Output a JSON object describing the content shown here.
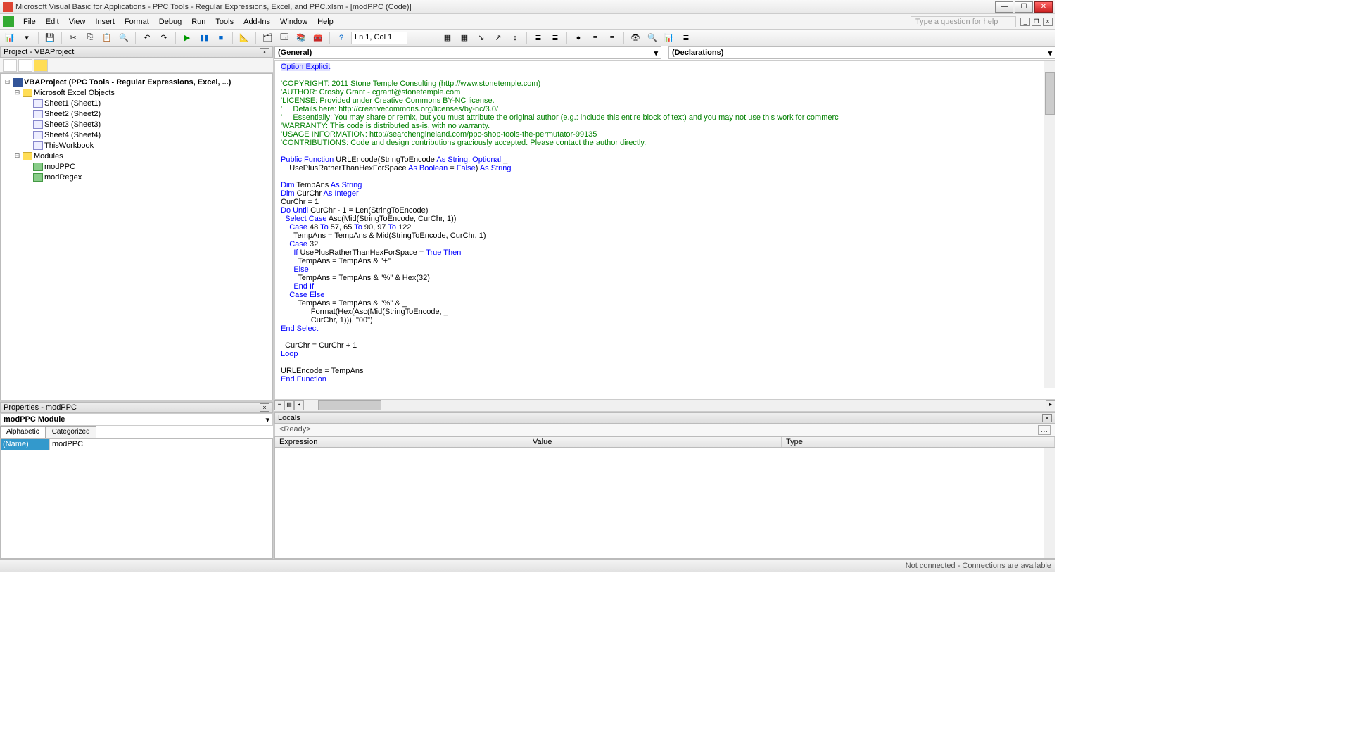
{
  "title": "Microsoft Visual Basic for Applications - PPC Tools - Regular Expressions, Excel, and PPC.xlsm - [modPPC (Code)]",
  "menus": [
    "File",
    "Edit",
    "View",
    "Insert",
    "Format",
    "Debug",
    "Run",
    "Tools",
    "Add-Ins",
    "Window",
    "Help"
  ],
  "question_placeholder": "Type a question for help",
  "position": "Ln 1, Col 1",
  "project": {
    "header": "Project - VBAProject",
    "root": "VBAProject (PPC Tools - Regular Expressions, Excel, ...)",
    "excel_folder": "Microsoft Excel Objects",
    "sheets": [
      "Sheet1 (Sheet1)",
      "Sheet2 (Sheet2)",
      "Sheet3 (Sheet3)",
      "Sheet4 (Sheet4)",
      "ThisWorkbook"
    ],
    "modules_folder": "Modules",
    "modules": [
      "modPPC",
      "modRegex"
    ]
  },
  "properties": {
    "header": "Properties - modPPC",
    "object": "modPPC Module",
    "tabs": [
      "Alphabetic",
      "Categorized"
    ],
    "name_key": "(Name)",
    "name_val": "modPPC"
  },
  "codecombo": {
    "left": "(General)",
    "right": "(Declarations)"
  },
  "locals": {
    "header": "Locals",
    "ready": "<Ready>",
    "cols": [
      "Expression",
      "Value",
      "Type"
    ]
  },
  "status": "Not connected - Connections are available",
  "code_lines": [
    {
      "t": "Option Explicit",
      "c": "kw",
      "hl": 1
    },
    {
      "t": ""
    },
    {
      "t": "'COPYRIGHT: 2011 Stone Temple Consulting (http://www.stonetemple.com)",
      "c": "cm"
    },
    {
      "t": "'AUTHOR: Crosby Grant - cgrant@stonetemple.com",
      "c": "cm"
    },
    {
      "t": "'LICENSE: Provided under Creative Commons BY-NC license.",
      "c": "cm"
    },
    {
      "t": "'     Details here: http://creativecommons.org/licenses/by-nc/3.0/",
      "c": "cm"
    },
    {
      "t": "'     Essentially: You may share or remix, but you must attribute the original author (e.g.: include this entire block of text) and you may not use this work for commerc",
      "c": "cm"
    },
    {
      "t": "'WARRANTY: This code is distributed as-is, with no warranty.",
      "c": "cm"
    },
    {
      "t": "'USAGE INFORMATION: http://searchengineland.com/ppc-shop-tools-the-permutator-99135",
      "c": "cm"
    },
    {
      "t": "'CONTRIBUTIONS: Code and design contributions graciously accepted. Please contact the author directly.",
      "c": "cm"
    },
    {
      "t": ""
    },
    {
      "t": "<kw>Public Function</kw> URLEncode(StringToEncode <kw>As String</kw>, <kw>Optional</kw> _"
    },
    {
      "t": "    UsePlusRatherThanHexForSpace <kw>As Boolean</kw> = <kw>False</kw>) <kw>As String</kw>"
    },
    {
      "t": ""
    },
    {
      "t": "<kw>Dim</kw> TempAns <kw>As String</kw>"
    },
    {
      "t": "<kw>Dim</kw> CurChr <kw>As Integer</kw>"
    },
    {
      "t": "CurChr = 1"
    },
    {
      "t": "<kw>Do Until</kw> CurChr - 1 = Len(StringToEncode)"
    },
    {
      "t": "  <kw>Select Case</kw> Asc(Mid(StringToEncode, CurChr, 1))"
    },
    {
      "t": "    <kw>Case</kw> 48 <kw>To</kw> 57, 65 <kw>To</kw> 90, 97 <kw>To</kw> 122"
    },
    {
      "t": "      TempAns = TempAns &amp; Mid(StringToEncode, CurChr, 1)"
    },
    {
      "t": "    <kw>Case</kw> 32"
    },
    {
      "t": "      <kw>If</kw> UsePlusRatherThanHexForSpace = <kw>True Then</kw>"
    },
    {
      "t": "        TempAns = TempAns &amp; \"+\""
    },
    {
      "t": "      <kw>Else</kw>"
    },
    {
      "t": "        TempAns = TempAns &amp; \"%\" &amp; Hex(32)"
    },
    {
      "t": "      <kw>End If</kw>"
    },
    {
      "t": "    <kw>Case Else</kw>"
    },
    {
      "t": "        TempAns = TempAns &amp; \"%\" &amp; _"
    },
    {
      "t": "              Format(Hex(Asc(Mid(StringToEncode, _"
    },
    {
      "t": "              CurChr, 1))), \"00\")"
    },
    {
      "t": "<kw>End Select</kw>"
    },
    {
      "t": ""
    },
    {
      "t": "  CurChr = CurChr + 1"
    },
    {
      "t": "<kw>Loop</kw>"
    },
    {
      "t": ""
    },
    {
      "t": "URLEncode = TempAns"
    },
    {
      "t": "<kw>End Function</kw>"
    }
  ]
}
